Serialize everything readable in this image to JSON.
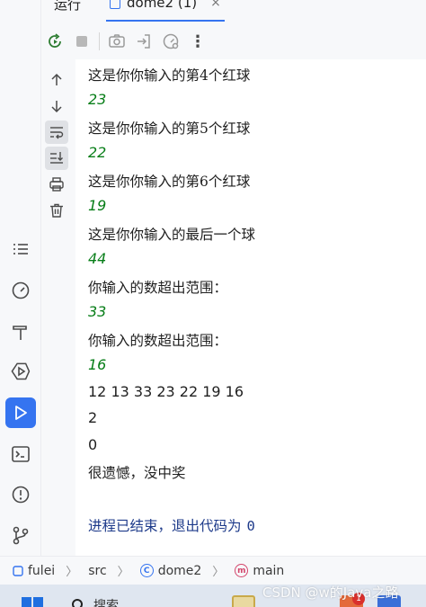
{
  "tabs": {
    "run_label": "运行",
    "file_tab_label": "dome2 (1)",
    "close_glyph": "×"
  },
  "toolbar": {
    "icons": [
      "rerun-icon",
      "stop-icon",
      "camera-icon",
      "restore-layout-icon",
      "profiler-icon",
      "more-icon"
    ],
    "more_glyph": "⋮"
  },
  "console": {
    "lines": [
      {
        "kind": "text",
        "value": "这是你你输入的第4个红球"
      },
      {
        "kind": "input",
        "value": "23"
      },
      {
        "kind": "text",
        "value": "这是你你输入的第5个红球"
      },
      {
        "kind": "input",
        "value": "22"
      },
      {
        "kind": "text",
        "value": "这是你你输入的第6个红球"
      },
      {
        "kind": "input",
        "value": "19"
      },
      {
        "kind": "text",
        "value": "这是你你输入的最后一个球"
      },
      {
        "kind": "input",
        "value": "44"
      },
      {
        "kind": "text",
        "value": "你输入的数超出范围："
      },
      {
        "kind": "input",
        "value": "33"
      },
      {
        "kind": "text",
        "value": "你输入的数超出范围："
      },
      {
        "kind": "input",
        "value": "16"
      },
      {
        "kind": "out",
        "value": "12 13 33 23 22 19 16"
      },
      {
        "kind": "out",
        "value": "2"
      },
      {
        "kind": "out",
        "value": "0"
      },
      {
        "kind": "text",
        "value": "很遗憾，没中奖"
      }
    ],
    "exit_message": "进程已结束，退出代码为",
    "exit_code": "0",
    "colors": {
      "input": "#067d17",
      "exit": "#1d3a8a",
      "text": "#1f1f1f"
    }
  },
  "statusbar": {
    "crumbs": [
      "fulei",
      "src",
      "dome2",
      "main"
    ],
    "separator": "〉"
  },
  "taskbar": {
    "search_text": "搜索",
    "notification_count": "1",
    "watermark": "CSDN @w的Java之路"
  },
  "accent": "#3574f0"
}
